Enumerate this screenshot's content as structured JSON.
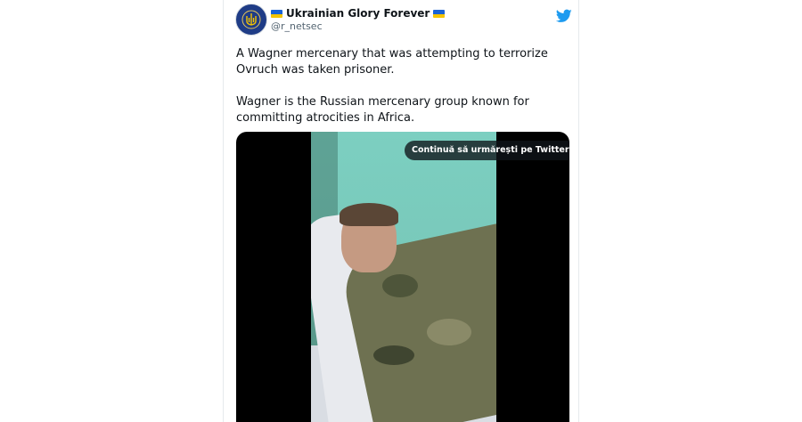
{
  "tweet": {
    "author": {
      "display_name": "Ukrainian Glory Forever",
      "handle": "@r_netsec"
    },
    "paragraphs": [
      "A Wagner mercenary that was attempting to terrorize Ovruch was taken prisoner.",
      "Wagner is the Russian mercenary group known for committing atrocities in Africa."
    ]
  },
  "media": {
    "overlay_label": "Continuă să urmărești pe Twitter"
  },
  "icons": {
    "brand": "twitter-bird-icon",
    "flag": "ukraine-flag-icon",
    "avatar": "trident-emblem-icon"
  },
  "colors": {
    "twitter_blue": "#1d9bf0",
    "handle_gray": "#536471",
    "flag_blue": "#1a63d6",
    "flag_yellow": "#f5c400"
  }
}
